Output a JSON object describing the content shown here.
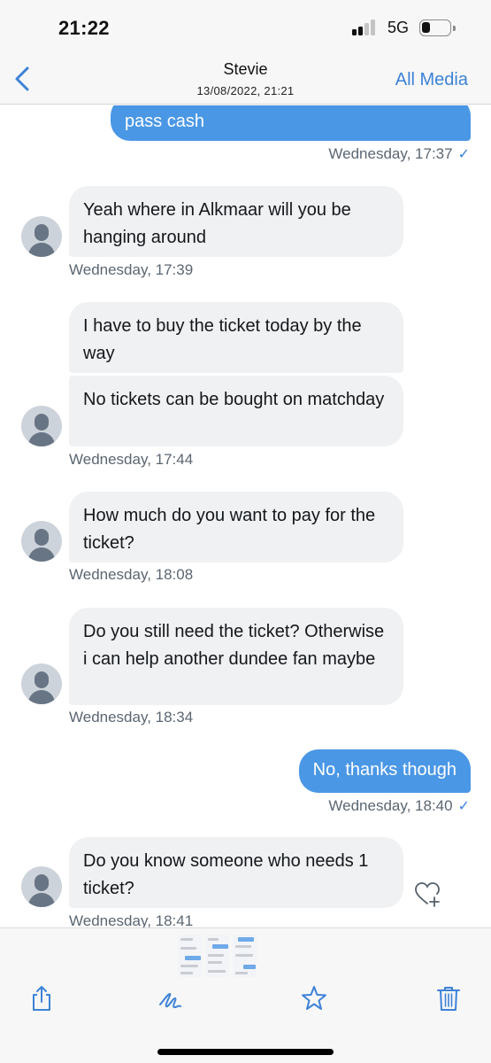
{
  "status_bar": {
    "time": "21:22",
    "network": "5G",
    "signal_bars_active": 2,
    "signal_bars_total": 4,
    "battery_level": 0.3
  },
  "nav": {
    "back_icon": "chevron-left-icon",
    "title": "Stevie",
    "subtitle": "13/08/2022, 21:21",
    "right_action": "All Media"
  },
  "colors": {
    "accent": "#3d82d8",
    "outgoing_bubble": "#4a97e6",
    "incoming_bubble": "#eff1f3",
    "timestamp": "#5b6672"
  },
  "messages": [
    {
      "direction": "out",
      "text": "pass cash",
      "timestamp": "Wednesday, 17:37",
      "status_icon": "check-icon"
    },
    {
      "direction": "in",
      "text": "Yeah where in Alkmaar will you be hanging around",
      "timestamp": "Wednesday, 17:39"
    },
    {
      "direction": "in",
      "text": "I have to buy the ticket today by the way"
    },
    {
      "direction": "in",
      "text": "No tickets can be bought on matchday",
      "timestamp": "Wednesday, 17:44"
    },
    {
      "direction": "in",
      "text": "How much do you want to pay for the ticket?",
      "timestamp": "Wednesday, 18:08"
    },
    {
      "direction": "in",
      "text": "Do you still need the ticket? Otherwise i can help another dundee fan maybe",
      "timestamp": "Wednesday, 18:34"
    },
    {
      "direction": "out",
      "text": "No, thanks though",
      "timestamp": "Wednesday, 18:40",
      "status_icon": "check-icon"
    },
    {
      "direction": "in",
      "text": "Do you know someone who needs 1 ticket?",
      "timestamp": "Wednesday, 18:41",
      "reaction_icon": "heart-plus-icon"
    }
  ],
  "check_glyph": "✓",
  "toolbar": {
    "items": [
      {
        "icon": "share-icon",
        "label": "Share"
      },
      {
        "icon": "markup-icon",
        "label": "Markup"
      },
      {
        "icon": "star-icon",
        "label": "Favourite"
      },
      {
        "icon": "trash-icon",
        "label": "Delete"
      }
    ],
    "thumbnail_count": 3
  }
}
